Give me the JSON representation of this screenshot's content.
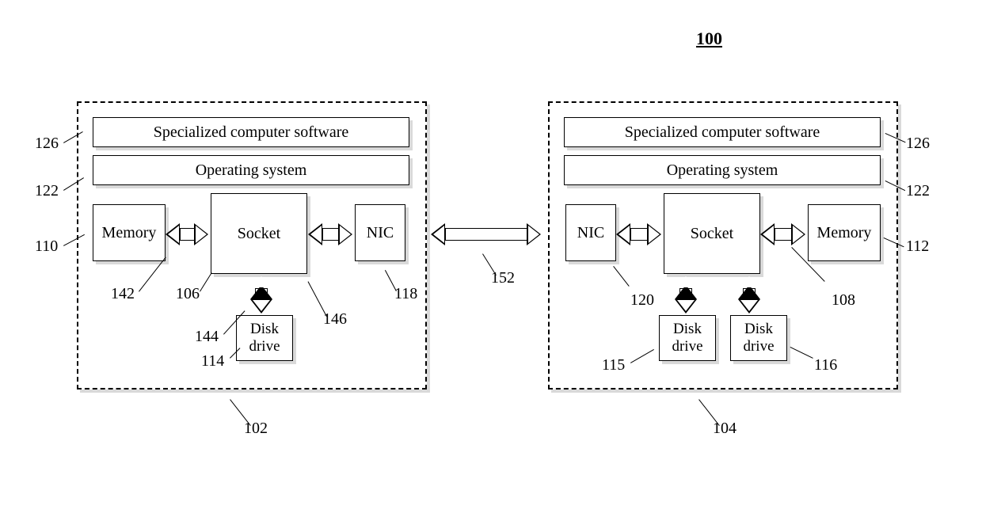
{
  "figure_ref": "100",
  "left": {
    "software_label": "Specialized computer software",
    "os_label": "Operating system",
    "memory_label": "Memory",
    "socket_label": "Socket",
    "nic_label": "NIC",
    "disk_label": "Disk drive"
  },
  "right": {
    "software_label": "Specialized computer software",
    "os_label": "Operating system",
    "nic_label": "NIC",
    "socket_label": "Socket",
    "memory_label": "Memory",
    "disk1_label": "Disk drive",
    "disk2_label": "Disk drive"
  },
  "refs": {
    "r100": "100",
    "r102": "102",
    "r104": "104",
    "r106": "106",
    "r108": "108",
    "r110": "110",
    "r112": "112",
    "r114": "114",
    "r115": "115",
    "r116": "116",
    "r118": "118",
    "r120": "120",
    "r122_l": "122",
    "r122_r": "122",
    "r126_l": "126",
    "r126_r": "126",
    "r142": "142",
    "r144": "144",
    "r146": "146",
    "r152": "152"
  }
}
